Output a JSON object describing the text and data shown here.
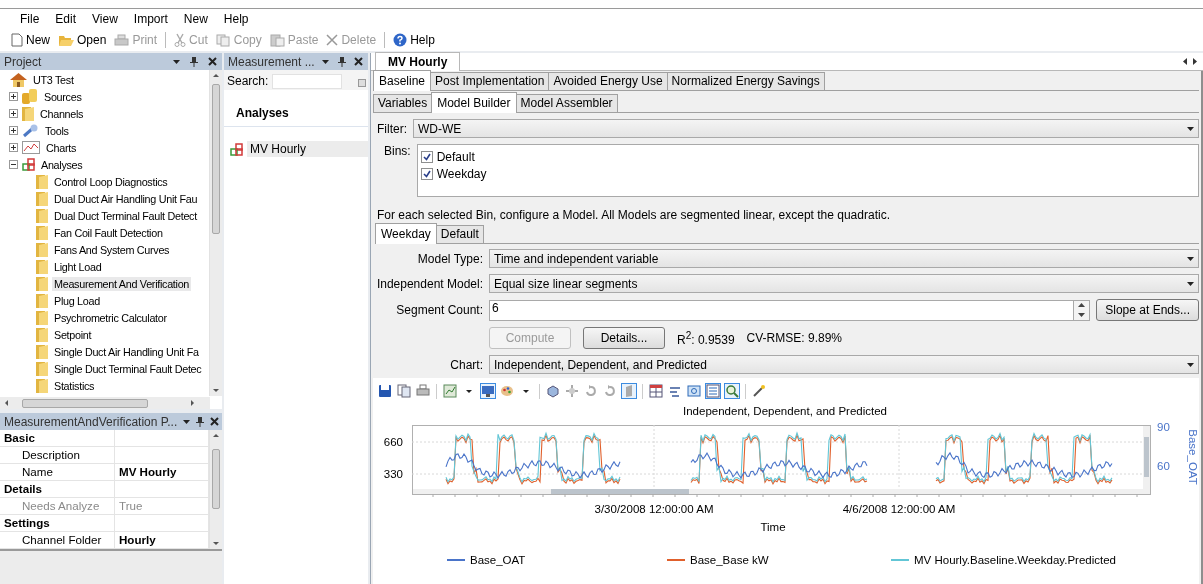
{
  "menu": [
    "File",
    "Edit",
    "View",
    "Import",
    "New",
    "Help"
  ],
  "toolbar": [
    {
      "kind": "new",
      "label": "New",
      "disabled": false
    },
    {
      "kind": "open",
      "label": "Open",
      "disabled": false
    },
    {
      "kind": "print",
      "label": "Print",
      "disabled": true
    },
    {
      "kind": "separator"
    },
    {
      "kind": "cut",
      "label": "Cut",
      "disabled": true
    },
    {
      "kind": "copy",
      "label": "Copy",
      "disabled": true
    },
    {
      "kind": "paste",
      "label": "Paste",
      "disabled": true
    },
    {
      "kind": "delete",
      "label": "Delete",
      "disabled": true
    },
    {
      "kind": "separator"
    },
    {
      "kind": "help",
      "label": "Help",
      "disabled": false
    }
  ],
  "project_panel": {
    "title": "Project",
    "tree": [
      {
        "label": "UT3 Test",
        "kind": "project",
        "selected": false,
        "children": [
          {
            "label": "Sources",
            "kind": "sources",
            "expanded": false,
            "selected": false
          },
          {
            "label": "Channels",
            "kind": "folder",
            "expanded": false,
            "selected": false
          },
          {
            "label": "Tools",
            "kind": "tools",
            "expanded": false,
            "selected": false
          },
          {
            "label": "Charts",
            "kind": "charts",
            "expanded": false,
            "selected": false
          },
          {
            "label": "Analyses",
            "kind": "analyses",
            "expanded": true,
            "selected": false,
            "children": [
              {
                "label": "Control Loop Diagnostics",
                "kind": "folder",
                "selected": false
              },
              {
                "label": "Dual Duct Air Handling Unit Fau",
                "kind": "folder",
                "selected": false
              },
              {
                "label": "Dual Duct Terminal Fault Detect",
                "kind": "folder",
                "selected": false
              },
              {
                "label": "Fan Coil Fault Detection",
                "kind": "folder",
                "selected": false
              },
              {
                "label": "Fans And System Curves",
                "kind": "folder",
                "selected": false
              },
              {
                "label": "Light Load",
                "kind": "folder",
                "selected": false
              },
              {
                "label": "Measurement And Verification",
                "kind": "folder",
                "selected": true
              },
              {
                "label": "Plug Load",
                "kind": "folder",
                "selected": false
              },
              {
                "label": "Psychrometric Calculator",
                "kind": "folder",
                "selected": false
              },
              {
                "label": "Setpoint",
                "kind": "folder",
                "selected": false
              },
              {
                "label": "Single Duct Air Handling Unit Fa",
                "kind": "folder",
                "selected": false
              },
              {
                "label": "Single Duct Terminal Fault Detec",
                "kind": "folder",
                "selected": false
              },
              {
                "label": "Statistics",
                "kind": "folder",
                "selected": false
              }
            ]
          }
        ]
      }
    ]
  },
  "properties_panel": {
    "title": "MeasurementAndVerification P...",
    "rows": [
      {
        "kind": "category",
        "label": "Basic"
      },
      {
        "kind": "property",
        "label": "Description",
        "disabled": false
      },
      {
        "kind": "property",
        "label": "Name",
        "value": "MV Hourly",
        "disabled": false,
        "modified": true
      },
      {
        "kind": "category",
        "label": "Details"
      },
      {
        "kind": "property",
        "label": "Needs Analyze",
        "value": "True",
        "disabled": true,
        "modified": false
      },
      {
        "kind": "category",
        "label": "Settings"
      },
      {
        "kind": "property",
        "label": "Channel Folder",
        "value": "Hourly",
        "disabled": false,
        "modified": true
      }
    ]
  },
  "explorer_panel": {
    "title": "Measurement ...",
    "search_label": "Search:",
    "heading": "Analyses",
    "items": [
      {
        "label": "MV Hourly",
        "selected": true
      }
    ]
  },
  "document": {
    "tabs": [
      {
        "label": "MV Hourly",
        "selected": true
      }
    ],
    "phase_tabs": [
      {
        "label": "Baseline",
        "selected": true
      },
      {
        "label": "Post Implementation",
        "selected": false
      },
      {
        "label": "Avoided Energy Use",
        "selected": false
      },
      {
        "label": "Normalized Energy Savings",
        "selected": false
      }
    ],
    "view_tabs": [
      {
        "label": "Variables",
        "selected": false
      },
      {
        "label": "Model Builder",
        "selected": true
      },
      {
        "label": "Model Assembler",
        "selected": false
      }
    ],
    "filter": {
      "label": "Filter:",
      "value": "WD-WE"
    },
    "bins": {
      "label": "Bins:",
      "items": [
        {
          "label": "Default",
          "checked": true
        },
        {
          "label": "Weekday",
          "checked": true
        }
      ]
    },
    "instructions": "For each selected Bin, configure a Model. All Models are segmented linear, except the quadratic.",
    "bin_tabs": [
      {
        "label": "Weekday",
        "selected": true
      },
      {
        "label": "Default",
        "selected": false
      }
    ],
    "model_type": {
      "label": "Model Type:",
      "value": "Time and independent variable"
    },
    "independent_model": {
      "label": "Independent Model:",
      "value": "Equal size linear segments"
    },
    "segment_count": {
      "label": "Segment Count:",
      "value": "6"
    },
    "slope_button": "Slope at Ends...",
    "compute_button": {
      "label": "Compute",
      "disabled": true
    },
    "details_button": "Details...",
    "r_squared": "R$^{2}$: 0.9539",
    "cv_rmse": "CV-RMSE: 9.89%",
    "chart_select": {
      "label": "Chart:",
      "value": "Independent, Dependent, and Predicted"
    },
    "chart_toolbar": [
      {
        "kind": "save",
        "pressed": false
      },
      {
        "kind": "copy",
        "pressed": false
      },
      {
        "kind": "print",
        "pressed": false
      },
      {
        "kind": "separator"
      },
      {
        "kind": "gallery",
        "pressed": false
      },
      {
        "kind": "caret",
        "pressed": false
      },
      {
        "kind": "monitor",
        "pressed": true
      },
      {
        "kind": "palette",
        "pressed": false
      },
      {
        "kind": "caret",
        "pressed": false
      },
      {
        "kind": "separator"
      },
      {
        "kind": "cube",
        "pressed": false
      },
      {
        "kind": "move",
        "pressed": false
      },
      {
        "kind": "rotate",
        "pressed": false
      },
      {
        "kind": "rotate",
        "pressed": false
      },
      {
        "kind": "wall",
        "pressed": true
      },
      {
        "kind": "separator"
      },
      {
        "kind": "table",
        "pressed": false
      },
      {
        "kind": "format",
        "pressed": false
      },
      {
        "kind": "preview",
        "pressed": false
      },
      {
        "kind": "legend",
        "pressed": true
      },
      {
        "kind": "zoom",
        "pressed": true
      },
      {
        "kind": "separator"
      },
      {
        "kind": "wand",
        "pressed": false
      }
    ],
    "chart": {
      "title": "Independent, Dependent, and Predicted",
      "y_ticks": [
        "660",
        "330"
      ],
      "y2_ticks": [
        "90",
        "60"
      ],
      "y2_label": "Base_OAT",
      "x_ticks": [
        "3/30/2008 12:00:00 AM",
        "4/6/2008 12:00:00 AM"
      ],
      "x_label": "Time",
      "legend": [
        {
          "label": "Base_OAT",
          "color": "#4a74c9"
        },
        {
          "label": "Base_Base kW",
          "color": "#e0602c"
        },
        {
          "label": "MV Hourly.Baseline.Weekday.Predicted",
          "color": "#62c6d6"
        }
      ]
    }
  }
}
